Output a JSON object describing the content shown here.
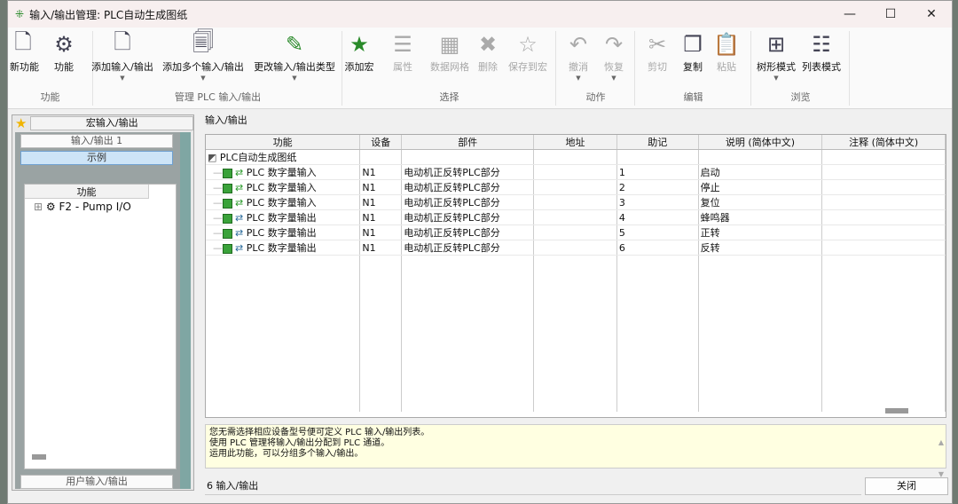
{
  "window": {
    "title": "输入/输出管理: PLC自动生成图纸",
    "minimize": "—",
    "maximize": "☐",
    "close": "✕"
  },
  "ribbon": {
    "groups": [
      {
        "label": "功能",
        "buttons": [
          {
            "label": "新功能",
            "icon": "new-function-icon"
          },
          {
            "label": "功能",
            "icon": "gears-icon"
          }
        ]
      },
      {
        "label": "管理 PLC 输入/输出",
        "buttons": [
          {
            "label": "添加输入/输出",
            "icon": "new-doc-icon",
            "dropdown": true
          },
          {
            "label": "添加多个输入/输出",
            "icon": "multi-doc-icon",
            "dropdown": true
          },
          {
            "label": "更改输入/输出类型",
            "icon": "io-edit-icon",
            "dropdown": true
          },
          {
            "label": "添加宏",
            "icon": "io-star-icon"
          }
        ]
      },
      {
        "label": "选择",
        "buttons": [
          {
            "label": "属性",
            "icon": "properties-icon",
            "disabled": true
          },
          {
            "label": "数据网格",
            "icon": "grid-icon",
            "disabled": true
          },
          {
            "label": "删除",
            "icon": "delete-icon",
            "disabled": true
          },
          {
            "label": "保存到宏",
            "icon": "save-macro-icon",
            "disabled": true
          }
        ]
      },
      {
        "label": "动作",
        "buttons": [
          {
            "label": "撤消",
            "icon": "undo-icon",
            "disabled": true,
            "dropdown": true
          },
          {
            "label": "恢复",
            "icon": "redo-icon",
            "disabled": true,
            "dropdown": true
          }
        ]
      },
      {
        "label": "编辑",
        "buttons": [
          {
            "label": "剪切",
            "icon": "cut-icon",
            "disabled": true
          },
          {
            "label": "复制",
            "icon": "copy-icon"
          },
          {
            "label": "粘贴",
            "icon": "paste-icon",
            "disabled": true
          }
        ]
      },
      {
        "label": "浏览",
        "buttons": [
          {
            "label": "树形模式",
            "icon": "tree-mode-icon",
            "dropdown": true
          },
          {
            "label": "列表模式",
            "icon": "list-mode-icon"
          }
        ]
      }
    ]
  },
  "left": {
    "header": "宏输入/输出",
    "bar1": "输入/输出 1",
    "example": "示例",
    "col": "功能",
    "tree_item": "F2 - Pump I/O",
    "bottom": "用户输入/输出"
  },
  "main": {
    "title": "输入/输出",
    "columns": [
      "功能",
      "设备",
      "部件",
      "地址",
      "助记",
      "说明 (简体中文)",
      "注释 (简体中文)"
    ],
    "root": "PLC自动生成图纸",
    "rows": [
      {
        "func": "PLC 数字量输入",
        "dev": "N1",
        "part": "电动机正反转PLC部分",
        "addr": "",
        "mn": "1",
        "desc": "启动",
        "note": ""
      },
      {
        "func": "PLC 数字量输入",
        "dev": "N1",
        "part": "电动机正反转PLC部分",
        "addr": "",
        "mn": "2",
        "desc": "停止",
        "note": ""
      },
      {
        "func": "PLC 数字量输入",
        "dev": "N1",
        "part": "电动机正反转PLC部分",
        "addr": "",
        "mn": "3",
        "desc": "复位",
        "note": ""
      },
      {
        "func": "PLC 数字量输出",
        "dev": "N1",
        "part": "电动机正反转PLC部分",
        "addr": "",
        "mn": "4",
        "desc": "蜂鸣器",
        "note": ""
      },
      {
        "func": "PLC 数字量输出",
        "dev": "N1",
        "part": "电动机正反转PLC部分",
        "addr": "",
        "mn": "5",
        "desc": "正转",
        "note": ""
      },
      {
        "func": "PLC 数字量输出",
        "dev": "N1",
        "part": "电动机正反转PLC部分",
        "addr": "",
        "mn": "6",
        "desc": "反转",
        "note": ""
      }
    ],
    "info": [
      "您无需选择相应设备型号便可定义 PLC 输入/输出列表。",
      "使用 PLC 管理将输入/输出分配到 PLC 通道。",
      "运用此功能，可以分组多个输入/输出。"
    ],
    "status": "6 输入/输出",
    "close": "关闭"
  }
}
